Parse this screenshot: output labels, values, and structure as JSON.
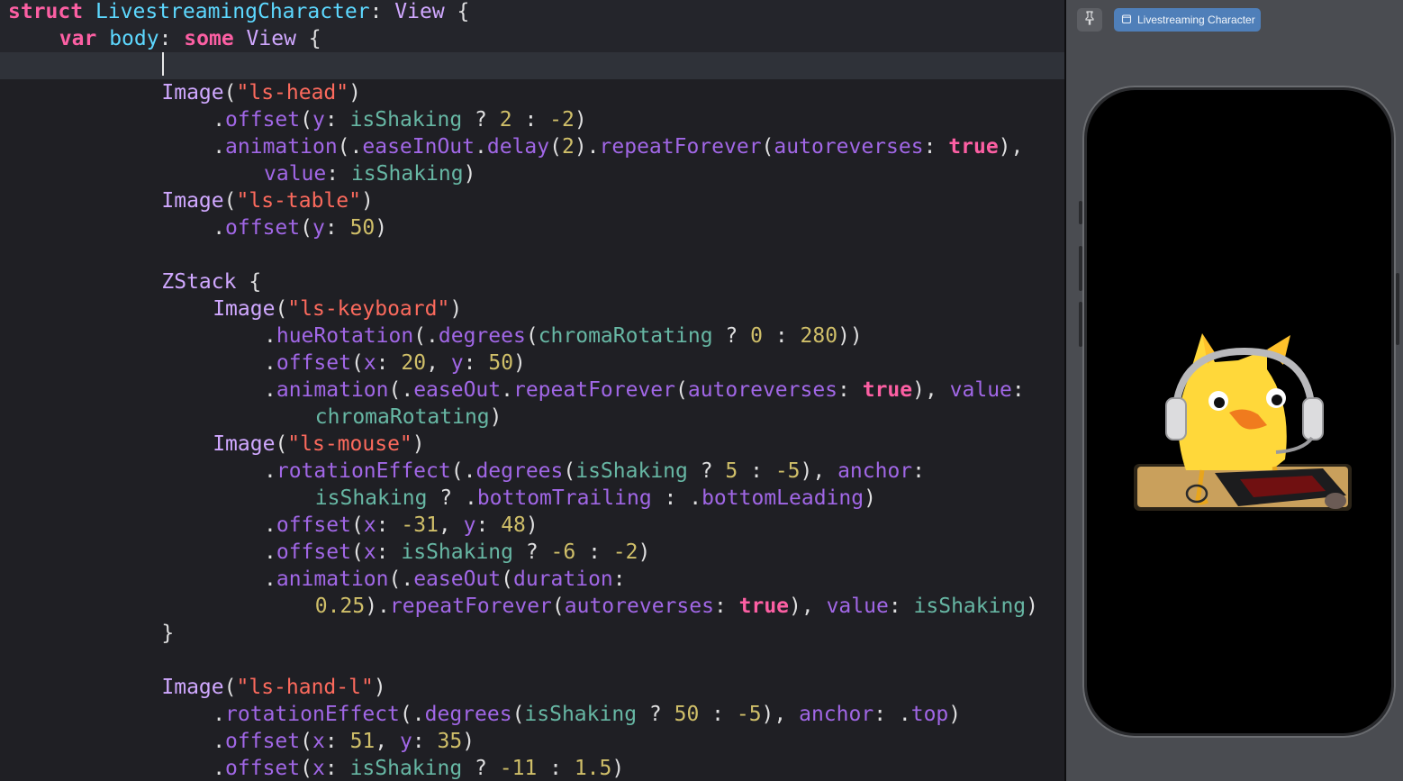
{
  "editor": {
    "lines": [
      {
        "indent": 0,
        "tokens": [
          {
            "t": "struct",
            "c": "kw"
          },
          {
            "t": " ",
            "c": "plain"
          },
          {
            "t": "LivestreamingCharacter",
            "c": "type"
          },
          {
            "t": ": ",
            "c": "plain"
          },
          {
            "t": "View",
            "c": "ptype"
          },
          {
            "t": " {",
            "c": "plain"
          }
        ],
        "sticky": true
      },
      {
        "indent": 4,
        "tokens": [
          {
            "t": "var",
            "c": "kw"
          },
          {
            "t": " ",
            "c": "plain"
          },
          {
            "t": "body",
            "c": "type"
          },
          {
            "t": ": ",
            "c": "plain"
          },
          {
            "t": "some",
            "c": "kw"
          },
          {
            "t": " ",
            "c": "plain"
          },
          {
            "t": "View",
            "c": "ptype"
          },
          {
            "t": " {",
            "c": "plain"
          }
        ],
        "sticky": true
      },
      {
        "indent": 0,
        "tokens": [],
        "current": true
      },
      {
        "indent": 12,
        "tokens": [
          {
            "t": "Image",
            "c": "ptype"
          },
          {
            "t": "(",
            "c": "plain"
          },
          {
            "t": "\"ls-head\"",
            "c": "str"
          },
          {
            "t": ")",
            "c": "plain"
          }
        ]
      },
      {
        "indent": 16,
        "tokens": [
          {
            "t": ".",
            "c": "plain"
          },
          {
            "t": "offset",
            "c": "fn"
          },
          {
            "t": "(",
            "c": "plain"
          },
          {
            "t": "y",
            "c": "lbl"
          },
          {
            "t": ": ",
            "c": "plain"
          },
          {
            "t": "isShaking",
            "c": "var"
          },
          {
            "t": " ? ",
            "c": "plain"
          },
          {
            "t": "2",
            "c": "num"
          },
          {
            "t": " : ",
            "c": "plain"
          },
          {
            "t": "-2",
            "c": "num"
          },
          {
            "t": ")",
            "c": "plain"
          }
        ]
      },
      {
        "indent": 16,
        "tokens": [
          {
            "t": ".",
            "c": "plain"
          },
          {
            "t": "animation",
            "c": "fn"
          },
          {
            "t": "(.",
            "c": "plain"
          },
          {
            "t": "easeInOut",
            "c": "prop"
          },
          {
            "t": ".",
            "c": "plain"
          },
          {
            "t": "delay",
            "c": "fn"
          },
          {
            "t": "(",
            "c": "plain"
          },
          {
            "t": "2",
            "c": "num"
          },
          {
            "t": ").",
            "c": "plain"
          },
          {
            "t": "repeatForever",
            "c": "fn"
          },
          {
            "t": "(",
            "c": "plain"
          },
          {
            "t": "autoreverses",
            "c": "lbl"
          },
          {
            "t": ": ",
            "c": "plain"
          },
          {
            "t": "true",
            "c": "kw"
          },
          {
            "t": "),",
            "c": "plain"
          }
        ]
      },
      {
        "indent": 20,
        "tokens": [
          {
            "t": "value",
            "c": "lbl"
          },
          {
            "t": ": ",
            "c": "plain"
          },
          {
            "t": "isShaking",
            "c": "var"
          },
          {
            "t": ")",
            "c": "plain"
          }
        ]
      },
      {
        "indent": 12,
        "tokens": [
          {
            "t": "Image",
            "c": "ptype"
          },
          {
            "t": "(",
            "c": "plain"
          },
          {
            "t": "\"ls-table\"",
            "c": "str"
          },
          {
            "t": ")",
            "c": "plain"
          }
        ]
      },
      {
        "indent": 16,
        "tokens": [
          {
            "t": ".",
            "c": "plain"
          },
          {
            "t": "offset",
            "c": "fn"
          },
          {
            "t": "(",
            "c": "plain"
          },
          {
            "t": "y",
            "c": "lbl"
          },
          {
            "t": ": ",
            "c": "plain"
          },
          {
            "t": "50",
            "c": "num"
          },
          {
            "t": ")",
            "c": "plain"
          }
        ]
      },
      {
        "indent": 0,
        "tokens": []
      },
      {
        "indent": 12,
        "tokens": [
          {
            "t": "ZStack",
            "c": "ptype"
          },
          {
            "t": " {",
            "c": "plain"
          }
        ]
      },
      {
        "indent": 16,
        "tokens": [
          {
            "t": "Image",
            "c": "ptype"
          },
          {
            "t": "(",
            "c": "plain"
          },
          {
            "t": "\"ls-keyboard\"",
            "c": "str"
          },
          {
            "t": ")",
            "c": "plain"
          }
        ]
      },
      {
        "indent": 20,
        "tokens": [
          {
            "t": ".",
            "c": "plain"
          },
          {
            "t": "hueRotation",
            "c": "fn"
          },
          {
            "t": "(.",
            "c": "plain"
          },
          {
            "t": "degrees",
            "c": "fn"
          },
          {
            "t": "(",
            "c": "plain"
          },
          {
            "t": "chromaRotating",
            "c": "var"
          },
          {
            "t": " ? ",
            "c": "plain"
          },
          {
            "t": "0",
            "c": "num"
          },
          {
            "t": " : ",
            "c": "plain"
          },
          {
            "t": "280",
            "c": "num"
          },
          {
            "t": "))",
            "c": "plain"
          }
        ]
      },
      {
        "indent": 20,
        "tokens": [
          {
            "t": ".",
            "c": "plain"
          },
          {
            "t": "offset",
            "c": "fn"
          },
          {
            "t": "(",
            "c": "plain"
          },
          {
            "t": "x",
            "c": "lbl"
          },
          {
            "t": ": ",
            "c": "plain"
          },
          {
            "t": "20",
            "c": "num"
          },
          {
            "t": ", ",
            "c": "plain"
          },
          {
            "t": "y",
            "c": "lbl"
          },
          {
            "t": ": ",
            "c": "plain"
          },
          {
            "t": "50",
            "c": "num"
          },
          {
            "t": ")",
            "c": "plain"
          }
        ]
      },
      {
        "indent": 20,
        "tokens": [
          {
            "t": ".",
            "c": "plain"
          },
          {
            "t": "animation",
            "c": "fn"
          },
          {
            "t": "(.",
            "c": "plain"
          },
          {
            "t": "easeOut",
            "c": "prop"
          },
          {
            "t": ".",
            "c": "plain"
          },
          {
            "t": "repeatForever",
            "c": "fn"
          },
          {
            "t": "(",
            "c": "plain"
          },
          {
            "t": "autoreverses",
            "c": "lbl"
          },
          {
            "t": ": ",
            "c": "plain"
          },
          {
            "t": "true",
            "c": "kw"
          },
          {
            "t": "), ",
            "c": "plain"
          },
          {
            "t": "value",
            "c": "lbl"
          },
          {
            "t": ":",
            "c": "plain"
          }
        ]
      },
      {
        "indent": 24,
        "tokens": [
          {
            "t": "chromaRotating",
            "c": "var"
          },
          {
            "t": ")",
            "c": "plain"
          }
        ]
      },
      {
        "indent": 16,
        "tokens": [
          {
            "t": "Image",
            "c": "ptype"
          },
          {
            "t": "(",
            "c": "plain"
          },
          {
            "t": "\"ls-mouse\"",
            "c": "str"
          },
          {
            "t": ")",
            "c": "plain"
          }
        ]
      },
      {
        "indent": 20,
        "tokens": [
          {
            "t": ".",
            "c": "plain"
          },
          {
            "t": "rotationEffect",
            "c": "fn"
          },
          {
            "t": "(.",
            "c": "plain"
          },
          {
            "t": "degrees",
            "c": "fn"
          },
          {
            "t": "(",
            "c": "plain"
          },
          {
            "t": "isShaking",
            "c": "var"
          },
          {
            "t": " ? ",
            "c": "plain"
          },
          {
            "t": "5",
            "c": "num"
          },
          {
            "t": " : ",
            "c": "plain"
          },
          {
            "t": "-5",
            "c": "num"
          },
          {
            "t": "), ",
            "c": "plain"
          },
          {
            "t": "anchor",
            "c": "lbl"
          },
          {
            "t": ":",
            "c": "plain"
          }
        ]
      },
      {
        "indent": 24,
        "tokens": [
          {
            "t": "isShaking",
            "c": "var"
          },
          {
            "t": " ? .",
            "c": "plain"
          },
          {
            "t": "bottomTrailing",
            "c": "prop"
          },
          {
            "t": " : .",
            "c": "plain"
          },
          {
            "t": "bottomLeading",
            "c": "prop"
          },
          {
            "t": ")",
            "c": "plain"
          }
        ]
      },
      {
        "indent": 20,
        "tokens": [
          {
            "t": ".",
            "c": "plain"
          },
          {
            "t": "offset",
            "c": "fn"
          },
          {
            "t": "(",
            "c": "plain"
          },
          {
            "t": "x",
            "c": "lbl"
          },
          {
            "t": ": ",
            "c": "plain"
          },
          {
            "t": "-31",
            "c": "num"
          },
          {
            "t": ", ",
            "c": "plain"
          },
          {
            "t": "y",
            "c": "lbl"
          },
          {
            "t": ": ",
            "c": "plain"
          },
          {
            "t": "48",
            "c": "num"
          },
          {
            "t": ")",
            "c": "plain"
          }
        ]
      },
      {
        "indent": 20,
        "tokens": [
          {
            "t": ".",
            "c": "plain"
          },
          {
            "t": "offset",
            "c": "fn"
          },
          {
            "t": "(",
            "c": "plain"
          },
          {
            "t": "x",
            "c": "lbl"
          },
          {
            "t": ": ",
            "c": "plain"
          },
          {
            "t": "isShaking",
            "c": "var"
          },
          {
            "t": " ? ",
            "c": "plain"
          },
          {
            "t": "-6",
            "c": "num"
          },
          {
            "t": " : ",
            "c": "plain"
          },
          {
            "t": "-2",
            "c": "num"
          },
          {
            "t": ")",
            "c": "plain"
          }
        ]
      },
      {
        "indent": 20,
        "tokens": [
          {
            "t": ".",
            "c": "plain"
          },
          {
            "t": "animation",
            "c": "fn"
          },
          {
            "t": "(.",
            "c": "plain"
          },
          {
            "t": "easeOut",
            "c": "fn"
          },
          {
            "t": "(",
            "c": "plain"
          },
          {
            "t": "duration",
            "c": "lbl"
          },
          {
            "t": ":",
            "c": "plain"
          }
        ]
      },
      {
        "indent": 24,
        "tokens": [
          {
            "t": "0.25",
            "c": "num"
          },
          {
            "t": ").",
            "c": "plain"
          },
          {
            "t": "repeatForever",
            "c": "fn"
          },
          {
            "t": "(",
            "c": "plain"
          },
          {
            "t": "autoreverses",
            "c": "lbl"
          },
          {
            "t": ": ",
            "c": "plain"
          },
          {
            "t": "true",
            "c": "kw"
          },
          {
            "t": "), ",
            "c": "plain"
          },
          {
            "t": "value",
            "c": "lbl"
          },
          {
            "t": ": ",
            "c": "plain"
          },
          {
            "t": "isShaking",
            "c": "var"
          },
          {
            "t": ")",
            "c": "plain"
          }
        ]
      },
      {
        "indent": 12,
        "tokens": [
          {
            "t": "}",
            "c": "plain"
          }
        ]
      },
      {
        "indent": 0,
        "tokens": []
      },
      {
        "indent": 12,
        "tokens": [
          {
            "t": "Image",
            "c": "ptype"
          },
          {
            "t": "(",
            "c": "plain"
          },
          {
            "t": "\"ls-hand-l\"",
            "c": "str"
          },
          {
            "t": ")",
            "c": "plain"
          }
        ]
      },
      {
        "indent": 16,
        "tokens": [
          {
            "t": ".",
            "c": "plain"
          },
          {
            "t": "rotationEffect",
            "c": "fn"
          },
          {
            "t": "(.",
            "c": "plain"
          },
          {
            "t": "degrees",
            "c": "fn"
          },
          {
            "t": "(",
            "c": "plain"
          },
          {
            "t": "isShaking",
            "c": "var"
          },
          {
            "t": " ? ",
            "c": "plain"
          },
          {
            "t": "50",
            "c": "num"
          },
          {
            "t": " : ",
            "c": "plain"
          },
          {
            "t": "-5",
            "c": "num"
          },
          {
            "t": "), ",
            "c": "plain"
          },
          {
            "t": "anchor",
            "c": "lbl"
          },
          {
            "t": ": .",
            "c": "plain"
          },
          {
            "t": "top",
            "c": "prop"
          },
          {
            "t": ")",
            "c": "plain"
          }
        ]
      },
      {
        "indent": 16,
        "tokens": [
          {
            "t": ".",
            "c": "plain"
          },
          {
            "t": "offset",
            "c": "fn"
          },
          {
            "t": "(",
            "c": "plain"
          },
          {
            "t": "x",
            "c": "lbl"
          },
          {
            "t": ": ",
            "c": "plain"
          },
          {
            "t": "51",
            "c": "num"
          },
          {
            "t": ", ",
            "c": "plain"
          },
          {
            "t": "y",
            "c": "lbl"
          },
          {
            "t": ": ",
            "c": "plain"
          },
          {
            "t": "35",
            "c": "num"
          },
          {
            "t": ")",
            "c": "plain"
          }
        ]
      },
      {
        "indent": 16,
        "tokens": [
          {
            "t": ".",
            "c": "plain"
          },
          {
            "t": "offset",
            "c": "fn"
          },
          {
            "t": "(",
            "c": "plain"
          },
          {
            "t": "x",
            "c": "lbl"
          },
          {
            "t": ": ",
            "c": "plain"
          },
          {
            "t": "isShaking",
            "c": "var"
          },
          {
            "t": " ? ",
            "c": "plain"
          },
          {
            "t": "-11",
            "c": "num"
          },
          {
            "t": " : ",
            "c": "plain"
          },
          {
            "t": "1.5",
            "c": "num"
          },
          {
            "t": ")",
            "c": "plain"
          }
        ]
      }
    ]
  },
  "preview": {
    "pin_icon": "pin-icon",
    "tab_icon": "device-icon",
    "tab_label": "Livestreaming Character",
    "character_image": "livestreaming-duck-character"
  },
  "colors": {
    "editor_bg": "#1f1f24",
    "keyword": "#fc5fa3",
    "type": "#5dd8ff",
    "string": "#fc6a5d",
    "number": "#d0bf69",
    "canvas_bg": "#4a4c51",
    "tab_accent": "#4f7fb9"
  }
}
